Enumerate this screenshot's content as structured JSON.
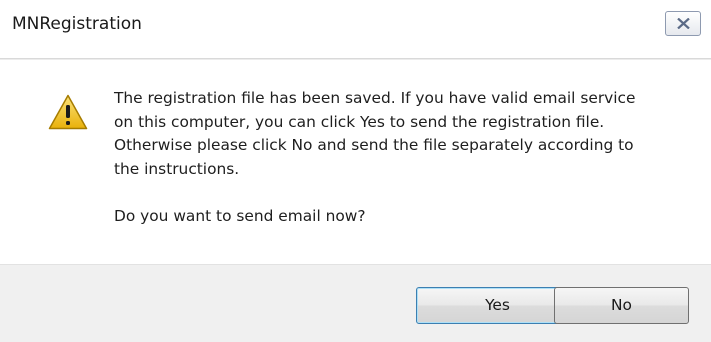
{
  "window": {
    "title": "MNRegistration"
  },
  "message": {
    "line1": "The registration file has been saved. If you have valid email service",
    "line2": "on this computer, you can click Yes to send the registration file.",
    "line3": "Otherwise please click No and send the file separately according to",
    "line4": "the instructions.",
    "question": "Do you want to send email now?"
  },
  "icons": {
    "warning": "warning-icon",
    "close": "close-icon"
  },
  "buttons": {
    "yes_label": "Yes",
    "no_label": "No"
  },
  "colors": {
    "warning_fill": "#f3c417",
    "default_button_border": "#3c7fb1"
  }
}
